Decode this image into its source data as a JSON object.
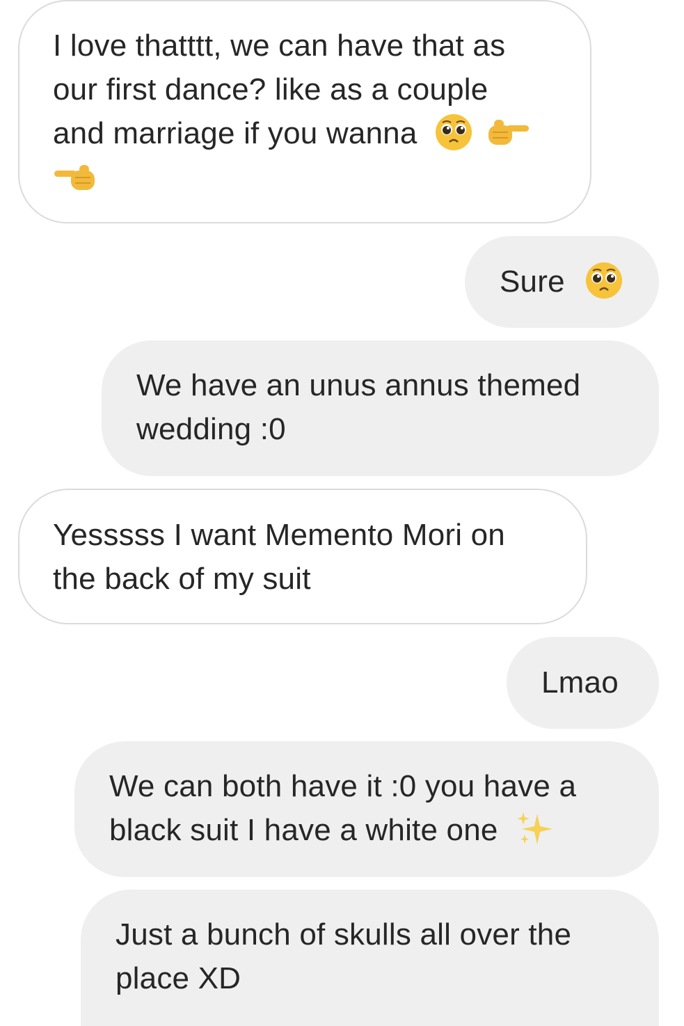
{
  "messages": [
    {
      "id": "m1",
      "direction": "received",
      "text_lines": [
        "I love thatttt, we can have that as",
        "our first dance? like as a couple",
        "and marriage if you wanna"
      ],
      "emoji": [
        "pleading-face",
        "pointing-right",
        "pointing-left"
      ]
    },
    {
      "id": "m2",
      "direction": "sent",
      "text": "Sure",
      "emoji": [
        "pleading-face"
      ]
    },
    {
      "id": "m3",
      "direction": "sent",
      "text_lines": [
        "We have an unus annus themed",
        "wedding :0"
      ]
    },
    {
      "id": "m4",
      "direction": "received",
      "text_lines": [
        "Yesssss I want Memento Mori on",
        "the back of my suit"
      ]
    },
    {
      "id": "m5",
      "direction": "sent",
      "text": "Lmao"
    },
    {
      "id": "m6",
      "direction": "sent",
      "text_lines": [
        "We can both have it :0 you have a",
        "black suit I have a white one"
      ],
      "emoji": [
        "sparkles"
      ]
    },
    {
      "id": "m7",
      "direction": "sent",
      "text_lines": [
        "Just a bunch of skulls all over the",
        "place XD"
      ]
    }
  ],
  "colors": {
    "sent_bubble": "#efefef",
    "received_bubble": "#ffffff",
    "received_border": "#dbdbdb",
    "text": "#262626",
    "emoji_yellow": "#f7c33a"
  }
}
